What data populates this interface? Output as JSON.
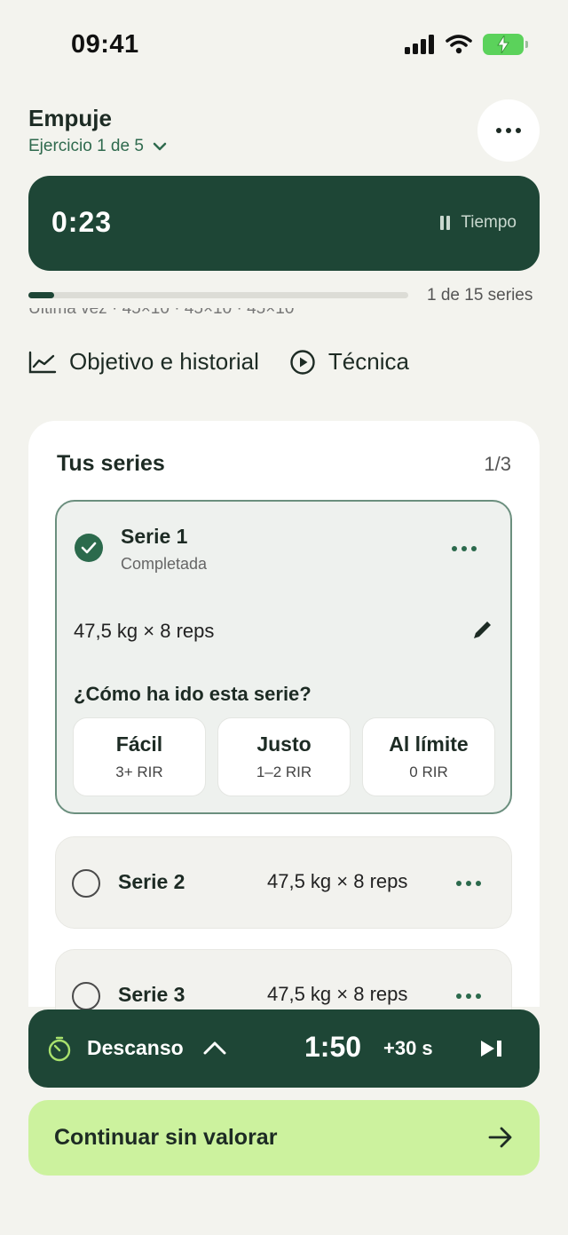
{
  "status_bar": {
    "time": "09:41"
  },
  "header": {
    "title": "Empuje",
    "subtitle": "Ejercicio 1 de 5",
    "more_icon": "more-dots-icon"
  },
  "timer": {
    "value": "0:23",
    "label": "Tiempo",
    "icon": "pause-icon"
  },
  "progress": {
    "label": "1 de 15 series",
    "fraction": 0.067
  },
  "last_time": "Última vez · 45×10 · 45×10 · 45×10",
  "links": [
    {
      "label": "Objetivo e historial",
      "icon": "chart-line-icon"
    },
    {
      "label": "Técnica",
      "icon": "play-circle-icon"
    }
  ],
  "series": {
    "title": "Tus series",
    "count": "1/3",
    "active_set": {
      "name": "Serie 1",
      "status": "Completada",
      "weight": "47,5 kg × 8 reps",
      "question": "¿Cómo ha ido esta serie?",
      "options": [
        {
          "label": "Fácil",
          "sub": "3+ RIR"
        },
        {
          "label": "Justo",
          "sub": "1–2 RIR"
        },
        {
          "label": "Al límite",
          "sub": "0 RIR"
        }
      ]
    },
    "rows": [
      {
        "name": "Serie 2",
        "weight": "47,5 kg × 8 reps"
      },
      {
        "name": "Serie 3",
        "weight": "47,5 kg × 8 reps"
      }
    ]
  },
  "rest": {
    "label": "Descanso",
    "time": "1:50",
    "add": "+30 s"
  },
  "continue": {
    "label": "Continuar sin valorar"
  },
  "colors": {
    "dark_green": "#1e4636",
    "accent_green": "#2b6a4c",
    "lime": "#ccf29e",
    "background": "#f3f3ee"
  }
}
